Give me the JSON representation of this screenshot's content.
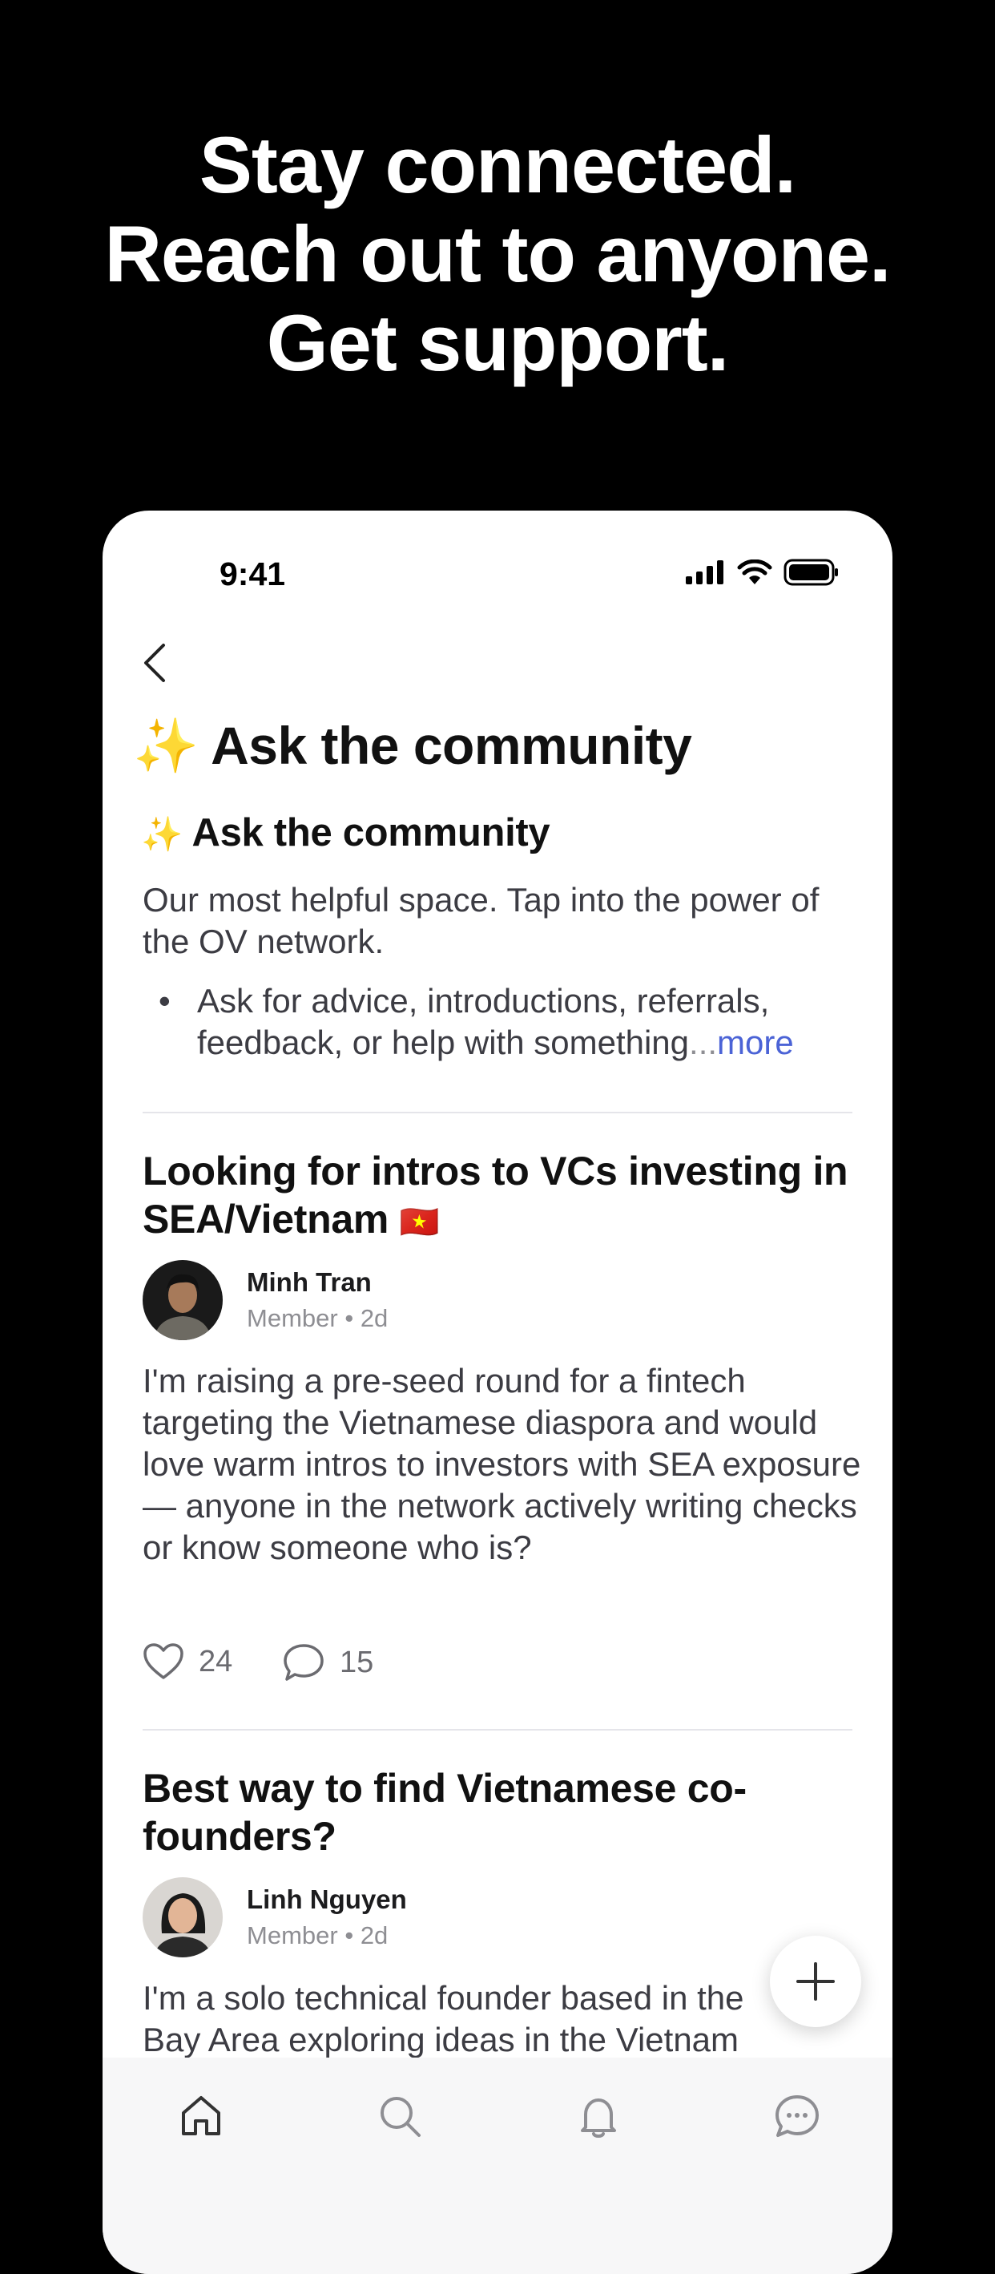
{
  "hero": {
    "line1": "Stay connected.",
    "line2": "Reach out to anyone.",
    "line3": "Get support."
  },
  "status_bar": {
    "time": "9:41"
  },
  "page": {
    "title": "Ask the community",
    "title_emoji": "✨"
  },
  "space": {
    "title": "Ask the community",
    "title_emoji": "✨",
    "description": "Our most helpful space. Tap into the power of the OV network.",
    "bullet_text": "Ask for advice, introductions, referrals, feedback, or help with something",
    "ellipsis": "...",
    "more_label": "more"
  },
  "posts": [
    {
      "title": "Looking for intros to VCs investing in SEA/Vietnam",
      "title_emoji": "🇻🇳",
      "author": "Minh Tran",
      "role": "Member",
      "separator": "•",
      "age": "2d",
      "body": "I'm raising a pre-seed round for a fintech targeting the Vietnamese diaspora and would love warm intros to investors with SEA exposure — anyone in the network actively writing checks or know someone who is?",
      "likes": "24",
      "comments": "15"
    },
    {
      "title": "Best way to find Vietnamese co-founders?",
      "author": "Linh Nguyen",
      "role": "Member",
      "separator": "•",
      "age": "2d",
      "body": "I'm a solo technical founder based in the Bay Area exploring ideas in the Vietnam"
    }
  ],
  "tabbar": {
    "items": [
      "home-icon",
      "search-icon",
      "bell-icon",
      "chat-icon"
    ]
  },
  "colors": {
    "accent_link": "#4b63d6",
    "background": "#000000",
    "card": "#ffffff"
  }
}
